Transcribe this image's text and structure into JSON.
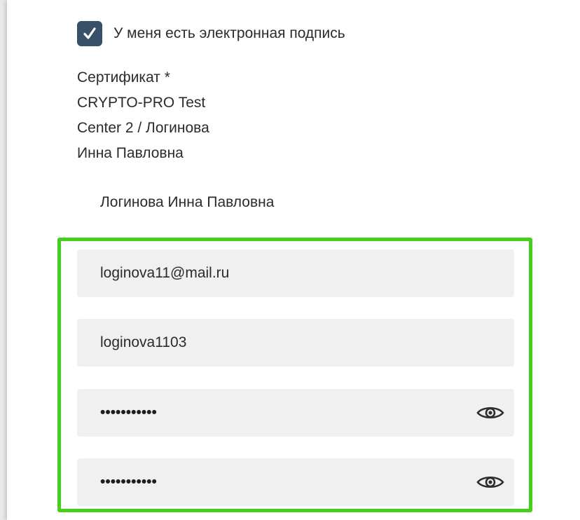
{
  "signature_checkbox": {
    "checked": true,
    "label": "У меня есть электронная подпись"
  },
  "certificate": {
    "label": "Сертификат *",
    "lines": [
      "CRYPTO-PRO Test",
      "Center 2 / Логинова",
      "Инна Павловна"
    ],
    "selected_name": "Логинова Инна Павловна"
  },
  "fields": {
    "email": {
      "value": "loginova11@mail.ru"
    },
    "login": {
      "value": "loginova1103"
    },
    "password": {
      "masked_value": "•••••••••••",
      "icon": "eye-icon"
    },
    "password_confirm": {
      "masked_value": "•••••••••••",
      "icon": "eye-icon"
    }
  },
  "colors": {
    "checkbox_bg": "#39506b",
    "highlight_border": "#45d01c",
    "field_bg": "#f0f0f0",
    "text": "#2b2b2b"
  }
}
